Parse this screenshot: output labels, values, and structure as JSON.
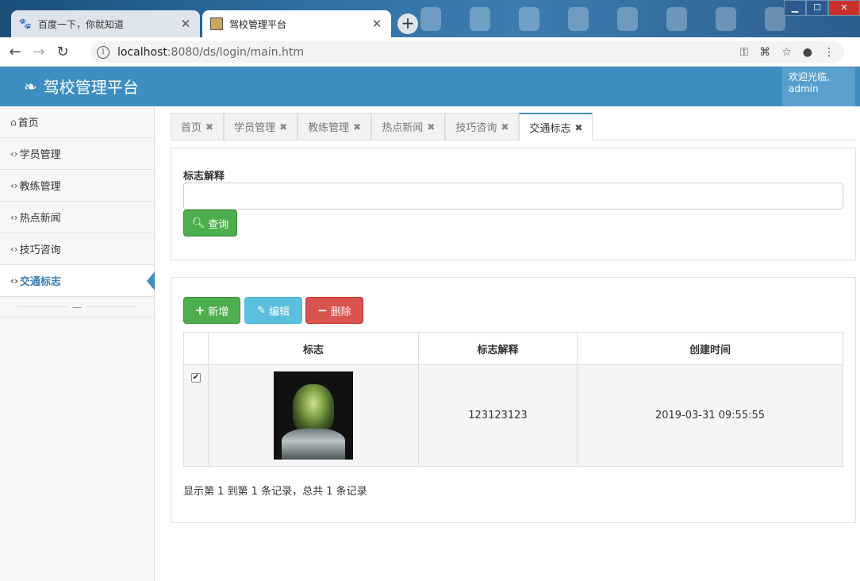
{
  "browser": {
    "tabs": [
      {
        "title": "百度一下，你就知道",
        "favicon": "paw-icon"
      },
      {
        "title": "驾校管理平台",
        "favicon": "image-icon"
      }
    ],
    "url_host": "localhost",
    "url_path": ":8080/ds/login/main.htm"
  },
  "app": {
    "brand": "驾校管理平台",
    "welcome_line1": "欢迎光临,",
    "welcome_user": "admin"
  },
  "sidebar": {
    "items": [
      {
        "label": "首页",
        "icon": "home-icon"
      },
      {
        "label": "学员管理",
        "icon": "code-icon"
      },
      {
        "label": "教练管理",
        "icon": "code-icon"
      },
      {
        "label": "热点新闻",
        "icon": "code-icon"
      },
      {
        "label": "技巧咨询",
        "icon": "code-icon"
      },
      {
        "label": "交通标志",
        "icon": "code-icon",
        "active": true
      }
    ],
    "collapse_label": "—"
  },
  "content_tabs": [
    {
      "label": "首页"
    },
    {
      "label": "学员管理"
    },
    {
      "label": "教练管理"
    },
    {
      "label": "热点新闻"
    },
    {
      "label": "技巧咨询"
    },
    {
      "label": "交通标志",
      "active": true
    }
  ],
  "search": {
    "label": "标志解释",
    "value": "",
    "button": "查询"
  },
  "toolbar": {
    "add": "新增",
    "edit": "编辑",
    "delete": "删除"
  },
  "table": {
    "columns": [
      "标志",
      "标志解释",
      "创建时间"
    ],
    "rows": [
      {
        "checked": true,
        "explain": "123123123",
        "created": "2019-03-31 09:55:55"
      }
    ]
  },
  "pager": "显示第 1 到第 1 条记录，总共 1 条记录",
  "colors": {
    "header": "#3e8ec1",
    "success": "#4cae4c",
    "info": "#5bc0de",
    "danger": "#d9534f"
  }
}
